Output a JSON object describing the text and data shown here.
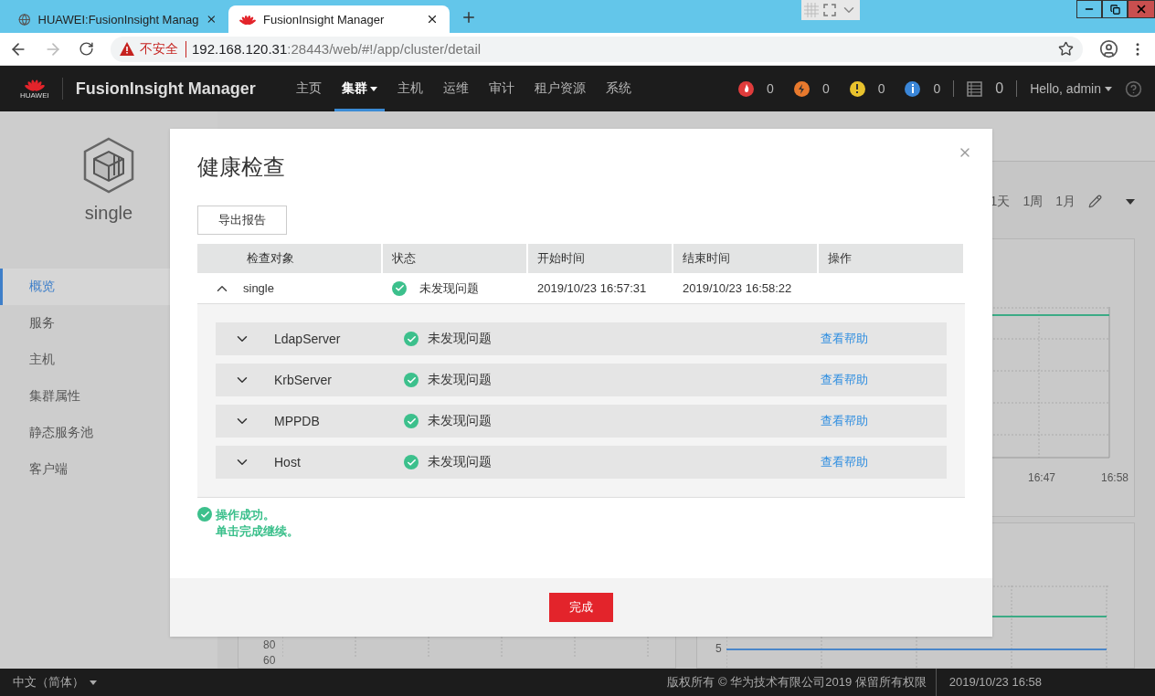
{
  "browser": {
    "tabs": [
      {
        "title": "HUAWEI:FusionInsight Manag",
        "kind": "globe",
        "selected": false
      },
      {
        "title": "FusionInsight Manager",
        "kind": "logo",
        "selected": true
      }
    ],
    "security": "不安全",
    "url_host": "192.168.120.31",
    "url_path": ":28443/web/#!/app/cluster/detail"
  },
  "header": {
    "logo_text": "HUAWEI",
    "product": "FusionInsight Manager",
    "nav": [
      {
        "label": "主页",
        "selected": false,
        "dropdown": false
      },
      {
        "label": "集群",
        "selected": true,
        "dropdown": true
      },
      {
        "label": "主机",
        "selected": false,
        "dropdown": false
      },
      {
        "label": "运维",
        "selected": false,
        "dropdown": false
      },
      {
        "label": "审计",
        "selected": false,
        "dropdown": false
      },
      {
        "label": "租户资源",
        "selected": false,
        "dropdown": false
      },
      {
        "label": "系统",
        "selected": false,
        "dropdown": false
      }
    ],
    "alarms": [
      {
        "kind": "critical",
        "color": "#e03c3c",
        "count": "0"
      },
      {
        "kind": "major",
        "color": "#e8792d",
        "count": "0"
      },
      {
        "kind": "minor",
        "color": "#e8c22d",
        "count": "0"
      },
      {
        "kind": "warning",
        "color": "#3a86d8",
        "count": "0"
      }
    ],
    "tasks": "0",
    "user": "Hello, admin"
  },
  "sidebar": {
    "cluster": "single",
    "items": [
      {
        "label": "概览",
        "selected": true
      },
      {
        "label": "服务",
        "selected": false
      },
      {
        "label": "主机",
        "selected": false
      },
      {
        "label": "集群属性",
        "selected": false
      },
      {
        "label": "静态服务池",
        "selected": false
      },
      {
        "label": "客户端",
        "selected": false
      }
    ]
  },
  "toolbar": {
    "ranges": [
      "1天",
      "1周",
      "1月"
    ]
  },
  "charts": {
    "top_right_x_labels": [
      "16:47",
      "16:58"
    ],
    "bottom_left_y_labels": [
      "80",
      "60"
    ],
    "bottom_right_y_label": "5"
  },
  "dialog": {
    "title": "健康检查",
    "export_button": "导出报告",
    "columns": [
      "检查对象",
      "状态",
      "开始时间",
      "结束时间",
      "操作"
    ],
    "row": {
      "expanded": true,
      "object": "single",
      "status": "未发现问题",
      "start": "2019/10/23 16:57:31",
      "end": "2019/10/23 16:58:22"
    },
    "items": [
      {
        "name": "LdapServer",
        "status": "未发现问题",
        "action": "查看帮助",
        "expanded": false
      },
      {
        "name": "KrbServer",
        "status": "未发现问题",
        "action": "查看帮助",
        "expanded": false
      },
      {
        "name": "MPPDB",
        "status": "未发现问题",
        "action": "查看帮助",
        "expanded": false
      },
      {
        "name": "Host",
        "status": "未发现问题",
        "action": "查看帮助",
        "expanded": false
      }
    ],
    "message": [
      "操作成功。",
      "单击完成继续。"
    ],
    "done_button": "完成"
  },
  "footer": {
    "language": "中文（简体）",
    "copyright": "版权所有 © 华为技术有限公司2019 保留所有权限",
    "time": "2019/10/23 16:58"
  }
}
